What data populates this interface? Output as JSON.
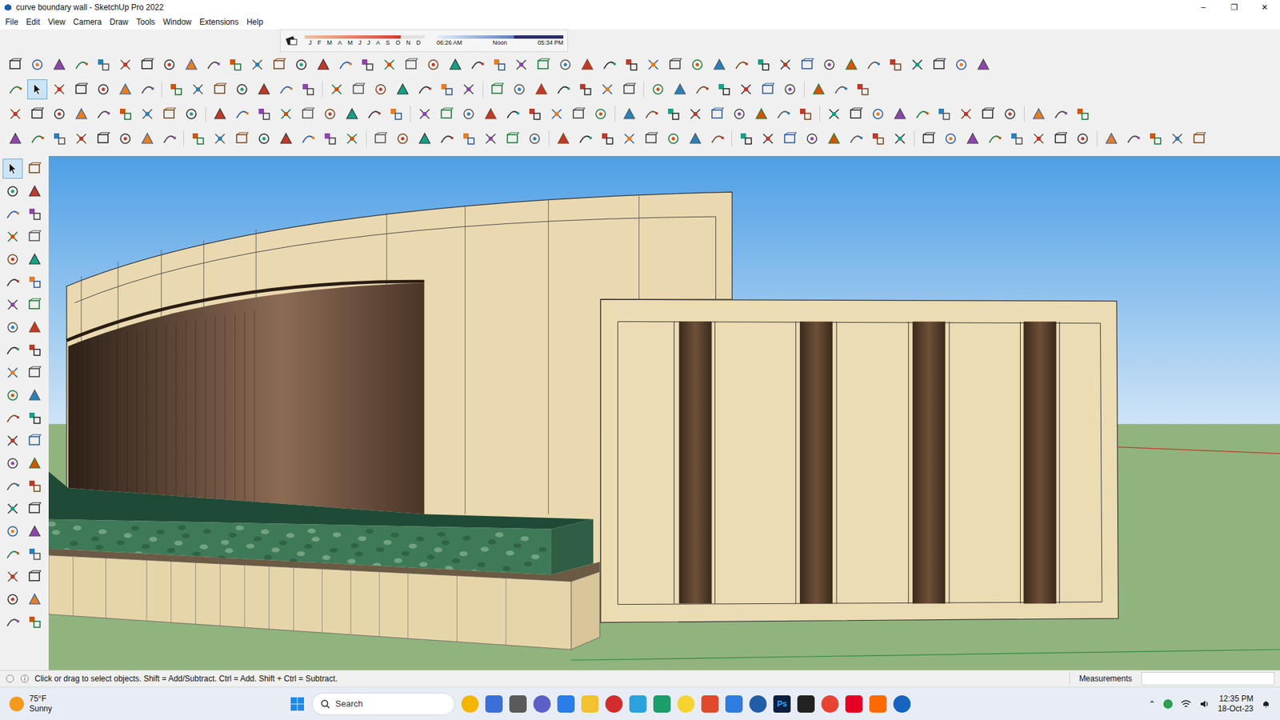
{
  "window": {
    "title": "curve boundary wall - SketchUp Pro 2022",
    "controls": [
      "–",
      "❐",
      "✕"
    ]
  },
  "menu": [
    "File",
    "Edit",
    "View",
    "Camera",
    "Draw",
    "Tools",
    "Window",
    "Extensions",
    "Help"
  ],
  "shadows": {
    "months": [
      "J",
      "F",
      "M",
      "A",
      "M",
      "J",
      "J",
      "A",
      "S",
      "O",
      "N",
      "D"
    ],
    "month_level": 0.8,
    "times": [
      "06:26 AM",
      "Noon",
      "05:34 PM"
    ],
    "time_level": 0.61
  },
  "select_tool": {
    "selected": true
  },
  "status_bar": {
    "hint": "Click or drag to select objects. Shift = Add/Subtract. Ctrl = Add. Shift + Ctrl = Subtract.",
    "measurements": "Measurements",
    "measurements_value": ""
  },
  "taskbar": {
    "weather": {
      "temp": "75°F",
      "condition": "Sunny"
    },
    "search": "Search",
    "ps_label": "Ps",
    "clock": {
      "time": "12:35 PM",
      "date": "18-Oct-23"
    }
  }
}
